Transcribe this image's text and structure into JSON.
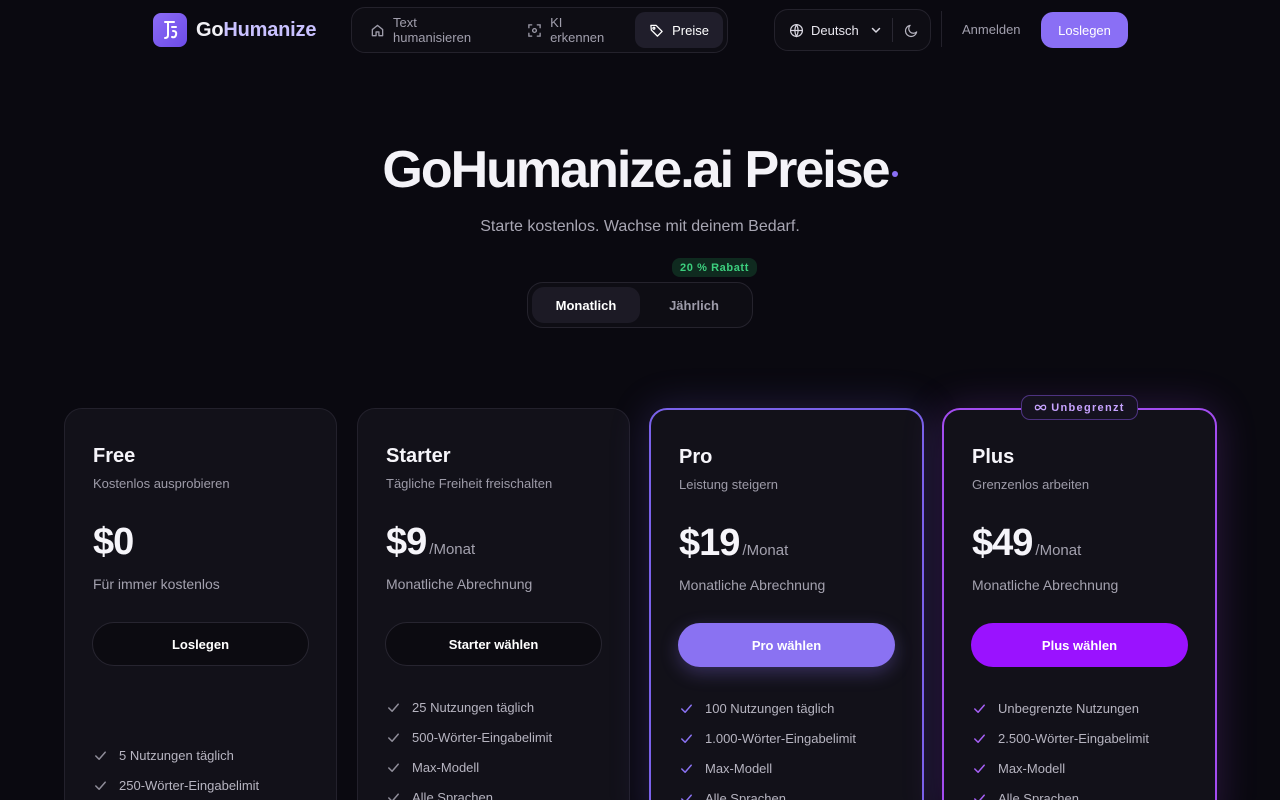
{
  "brand": {
    "name_part1": "Go",
    "name_part2": "Humanize"
  },
  "nav": {
    "items": [
      {
        "label": "Text humanisieren",
        "icon": "home-icon"
      },
      {
        "label": "KI erkennen",
        "icon": "scan-icon"
      },
      {
        "label": "Preise",
        "icon": "tag-icon",
        "active": true
      }
    ]
  },
  "header": {
    "language": "Deutsch",
    "signin_label": "Anmelden",
    "cta_label": "Loslegen"
  },
  "hero": {
    "title": "GoHumanize.ai Preise",
    "subtitle": "Starte kostenlos. Wachse mit deinem Bedarf."
  },
  "billing": {
    "monthly_label": "Monatlich",
    "yearly_label": "Jährlich",
    "discount_label": "20 % Rabatt",
    "selected": "monthly"
  },
  "plans": [
    {
      "name": "Free",
      "desc": "Kostenlos ausprobieren",
      "price": "$0",
      "per": "",
      "billing": "Für immer kostenlos",
      "button": "Loslegen",
      "features": [
        "5 Nutzungen täglich",
        "250-Wörter-Eingabelimit"
      ]
    },
    {
      "name": "Starter",
      "desc": "Tägliche Freiheit freischalten",
      "price": "$9",
      "per": "/Monat",
      "billing": "Monatliche Abrechnung",
      "button": "Starter wählen",
      "features": [
        "25 Nutzungen täglich",
        "500-Wörter-Eingabelimit",
        "Max-Modell",
        "Alle Sprachen"
      ]
    },
    {
      "name": "Pro",
      "desc": "Leistung steigern",
      "price": "$19",
      "per": "/Monat",
      "billing": "Monatliche Abrechnung",
      "button": "Pro wählen",
      "features": [
        "100 Nutzungen täglich",
        "1.000-Wörter-Eingabelimit",
        "Max-Modell",
        "Alle Sprachen"
      ]
    },
    {
      "name": "Plus",
      "desc": "Grenzenlos arbeiten",
      "price": "$49",
      "per": "/Monat",
      "billing": "Monatliche Abrechnung",
      "button": "Plus wählen",
      "badge": "Unbegrenzt",
      "features": [
        "Unbegrenzte Nutzungen",
        "2.500-Wörter-Eingabelimit",
        "Max-Modell",
        "Alle Sprachen"
      ]
    }
  ],
  "colors": {
    "accent": "#8a6ff5",
    "plus_accent": "#9a12ff",
    "discount_green": "#3ccf7e",
    "background": "#0a0910"
  }
}
